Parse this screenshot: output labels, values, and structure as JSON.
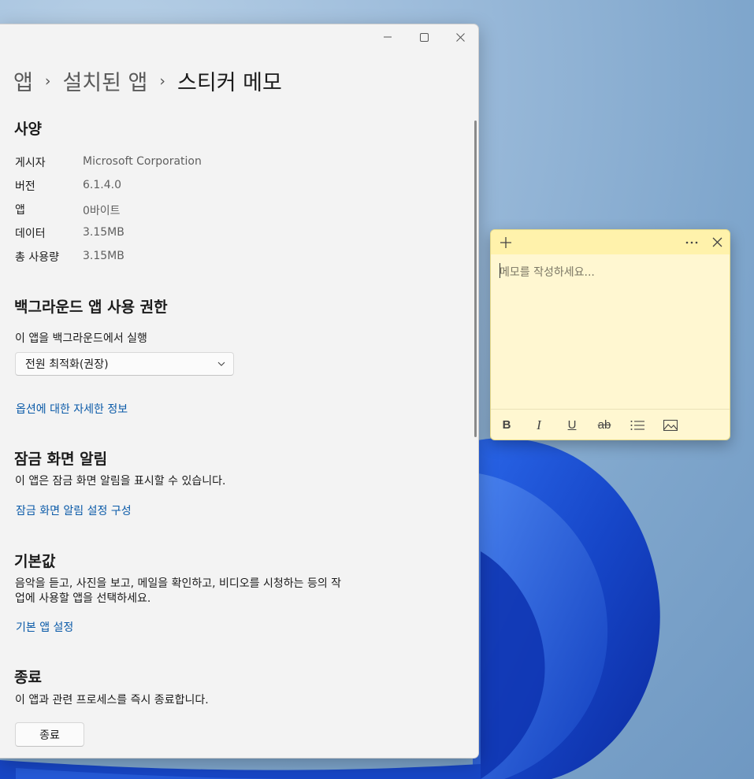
{
  "window": {
    "controls": [
      "minimize-icon",
      "maximize-icon",
      "close-icon"
    ]
  },
  "breadcrumb": {
    "items": [
      "앱",
      "설치된 앱",
      "스티커 메모"
    ],
    "separator": "›"
  },
  "specs": {
    "heading": "사양",
    "rows": [
      {
        "label": "게시자",
        "value": "Microsoft Corporation"
      },
      {
        "label": "버전",
        "value": "6.1.4.0"
      },
      {
        "label": "앱",
        "value": "0바이트"
      },
      {
        "label": "데이터",
        "value": "3.15MB"
      },
      {
        "label": "총 사용량",
        "value": "3.15MB"
      }
    ]
  },
  "background": {
    "heading": "백그라운드 앱 사용 권한",
    "prompt": "이 앱을 백그라운드에서 실행",
    "selected": "전원 최적화(권장)",
    "link": "옵션에 대한 자세한 정보"
  },
  "lockscreen": {
    "heading": "잠금 화면 알림",
    "description": "이 앱은 잠금 화면 알림을 표시할 수 있습니다.",
    "link": "잠금 화면 알림 설정 구성"
  },
  "defaults": {
    "heading": "기본값",
    "description_line1": "음악을 듣고, 사진을 보고, 메일을 확인하고, 비디오를 시청하는 등의 작",
    "description_line2": "업에 사용할 앱을 선택하세요.",
    "link": "기본 앱 설정"
  },
  "terminate": {
    "heading": "종료",
    "description": "이 앱과 관련 프로세스를 즉시 종료합니다.",
    "button": "종료"
  },
  "sticky": {
    "placeholder": "메모를 작성하세요...",
    "title_icons": [
      "add-icon",
      "more-icon",
      "close-icon"
    ],
    "toolbar": {
      "bold": "B",
      "italic": "I",
      "underline": "U",
      "strike": "ab",
      "list_icon": "bullet-list-icon",
      "image_icon": "image-icon"
    },
    "colors": {
      "body": "#fff7d1",
      "title": "#fff2ab"
    }
  },
  "colors": {
    "link": "#0a5aa8",
    "window_bg": "#f3f3f3",
    "bloom_blue": "#1d4fd0"
  }
}
